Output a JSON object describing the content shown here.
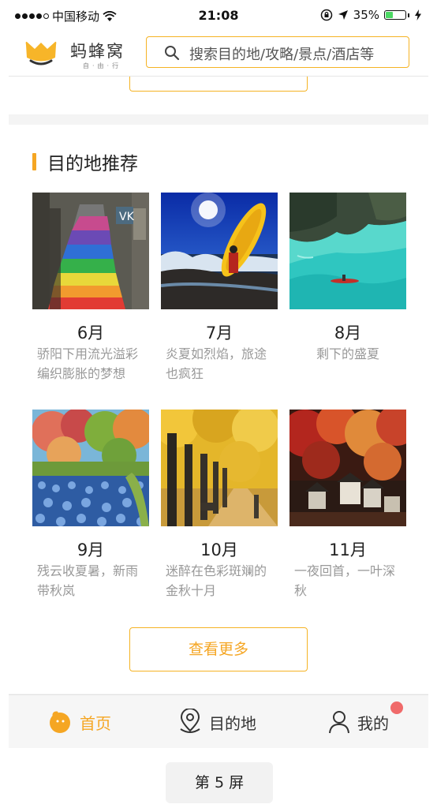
{
  "status_bar": {
    "carrier": "中国移动",
    "time": "21:08",
    "battery": "35%",
    "battery_level": 0.35
  },
  "header": {
    "app_name": "蚂蜂窝",
    "app_subtitle": "自·由·行",
    "search_placeholder": "搜索目的地/攻略/景点/酒店等"
  },
  "section": {
    "title": "目的地推荐",
    "items": [
      {
        "month": "6月",
        "desc": "骄阳下用流光溢彩编织膨胀的梦想",
        "image": "rainbow-stairs"
      },
      {
        "month": "7月",
        "desc": "炎夏如烈焰，旅途也疯狂",
        "image": "kayak-waves"
      },
      {
        "month": "8月",
        "desc": "剩下的盛夏",
        "image": "lagoon-boat"
      },
      {
        "month": "9月",
        "desc": "残云收夏暑，新雨带秋岚",
        "image": "autumn-pond"
      },
      {
        "month": "10月",
        "desc": "迷醉在色彩斑斓的金秋十月",
        "image": "ginkgo-avenue"
      },
      {
        "month": "11月",
        "desc": "一夜回首，一叶深秋",
        "image": "red-forest-village"
      }
    ],
    "more_label": "查看更多"
  },
  "tabbar": {
    "home": "首页",
    "destination": "目的地",
    "mine": "我的"
  },
  "page_label": "第 5 屏",
  "colors": {
    "accent": "#f5a623",
    "border_accent": "#f5b324",
    "badge": "#f06a6a"
  }
}
